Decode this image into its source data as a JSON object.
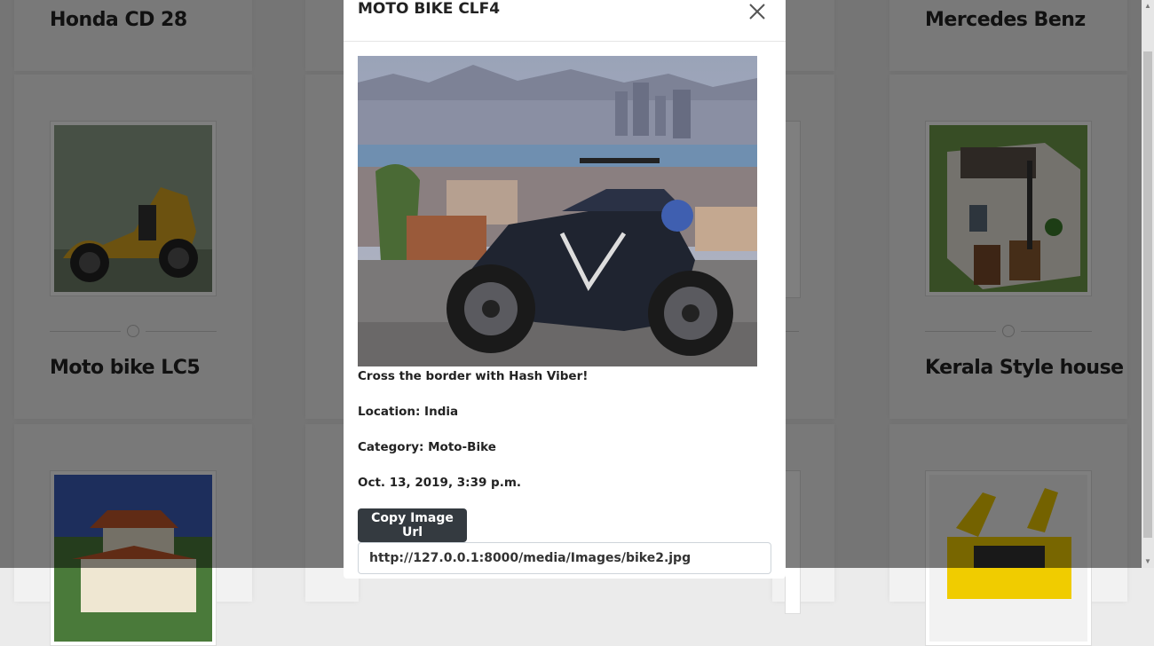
{
  "gallery": {
    "card_left_top": {
      "title": "Honda CD 28"
    },
    "card_right_top": {
      "title": "Mercedes Benz"
    },
    "card_left_mid": {
      "title": "Moto bike LC5",
      "image_icon": "motorbike-yellow-icon"
    },
    "card_right_mid": {
      "title": "Kerala Style house",
      "image_icon": "house-icon"
    },
    "card_left_bottom": {
      "image_icon": "house-tile-roof-icon"
    },
    "card_right_bottom": {
      "image_icon": "sports-car-yellow-icon"
    }
  },
  "modal": {
    "title": "MOTO BIKE CLF4",
    "close_icon": "close-icon",
    "image_icon": "motorbike-city-photo",
    "caption": "Cross the border with Hash Viber!",
    "location": "Location: India",
    "category": "Category: Moto-Bike",
    "date": "Oct. 13, 2019, 3:39 p.m.",
    "copy_button_label": "Copy Image Url",
    "url_value": "http://127.0.0.1:8000/media/Images/bike2.jpg"
  },
  "colors": {
    "overlay": "#000000",
    "button_bg": "#343a40",
    "card_bg": "#f2f2f2"
  }
}
